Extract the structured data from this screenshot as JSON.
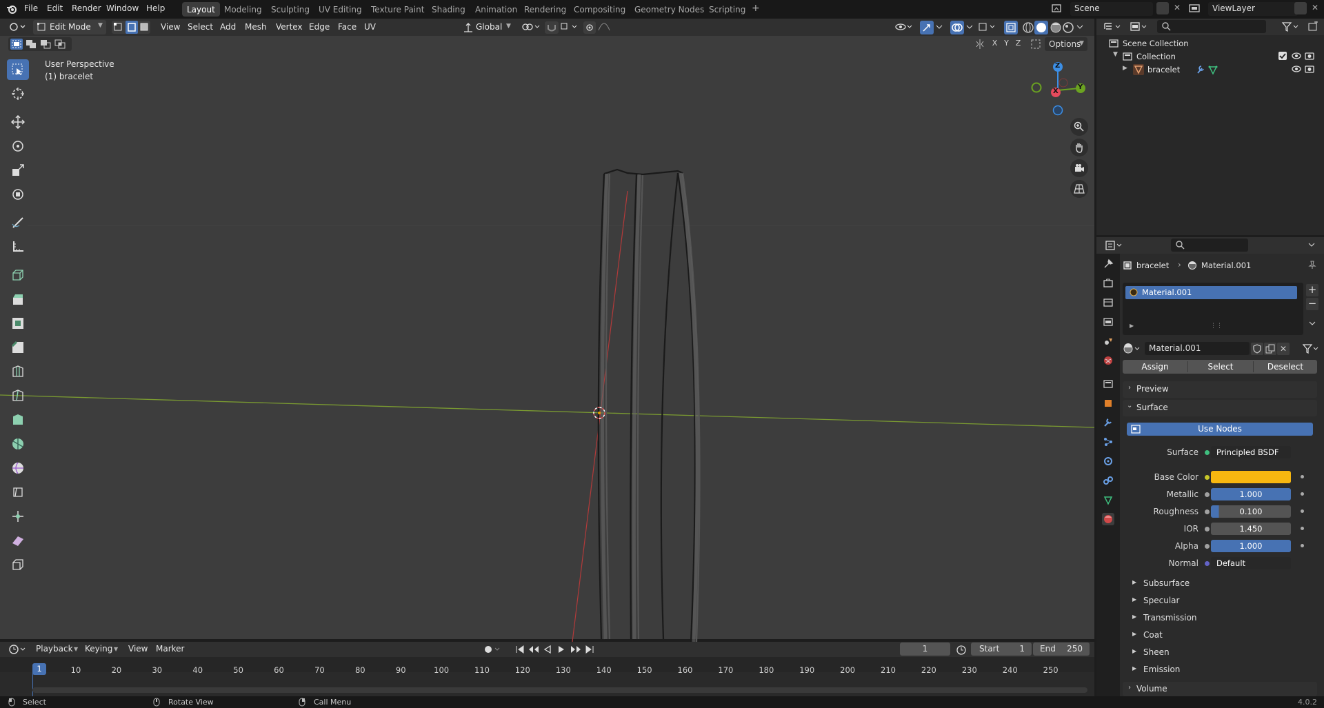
{
  "topbar": {
    "menus": [
      "File",
      "Edit",
      "Render",
      "Window",
      "Help"
    ],
    "workspaces": [
      "Layout",
      "Modeling",
      "Sculpting",
      "UV Editing",
      "Texture Paint",
      "Shading",
      "Animation",
      "Rendering",
      "Compositing",
      "Geometry Nodes",
      "Scripting"
    ],
    "active_workspace": "Layout",
    "scene": "Scene",
    "view_layer": "ViewLayer"
  },
  "viewport_header": {
    "mode": "Edit Mode",
    "menus": [
      "View",
      "Select",
      "Add",
      "Mesh",
      "Vertex",
      "Edge",
      "Face",
      "UV"
    ],
    "transform_orientation": "Global",
    "axes": [
      "X",
      "Y",
      "Z"
    ],
    "options": "Options"
  },
  "viewport": {
    "perspective": "User Perspective",
    "object": "(1) bracelet",
    "gizmo_axes": {
      "z": "Z",
      "x": "X",
      "y": "Y"
    }
  },
  "outliner": {
    "scene_collection": "Scene Collection",
    "collection": "Collection",
    "object": "bracelet"
  },
  "properties": {
    "breadcrumb_object": "bracelet",
    "breadcrumb_material": "Material.001",
    "slot": "Material.001",
    "material_name": "Material.001",
    "buttons": {
      "assign": "Assign",
      "select": "Select",
      "deselect": "Deselect"
    },
    "panels": {
      "preview": "Preview",
      "surface": "Surface",
      "volume": "Volume"
    },
    "use_nodes": "Use Nodes",
    "surface_label": "Surface",
    "surface_value": "Principled BSDF",
    "inputs": [
      {
        "label": "Base Color",
        "value": "",
        "color": "#f7b710"
      },
      {
        "label": "Metallic",
        "value": "1.000",
        "fill": 1.0
      },
      {
        "label": "Roughness",
        "value": "0.100",
        "fill": 0.1
      },
      {
        "label": "IOR",
        "value": "1.450",
        "fill": 0.0
      },
      {
        "label": "Alpha",
        "value": "1.000",
        "fill": 1.0
      },
      {
        "label": "Normal",
        "value": "Default"
      }
    ],
    "subpanels": [
      "Subsurface",
      "Specular",
      "Transmission",
      "Coat",
      "Sheen",
      "Emission"
    ]
  },
  "timeline": {
    "menus": [
      "Playback",
      "Keying",
      "View",
      "Marker"
    ],
    "current_frame": "1",
    "start_label": "Start",
    "start": "1",
    "end_label": "End",
    "end": "250",
    "ruler": [
      "1",
      "10",
      "20",
      "30",
      "40",
      "50",
      "60",
      "70",
      "80",
      "90",
      "100",
      "110",
      "120",
      "130",
      "140",
      "150",
      "160",
      "170",
      "180",
      "190",
      "200",
      "210",
      "220",
      "230",
      "240",
      "250"
    ]
  },
  "statusbar": {
    "select": "Select",
    "rotate": "Rotate View",
    "call_menu": "Call Menu",
    "version": "4.0.2"
  },
  "colors": {
    "accent": "#4772b3",
    "base_color": "#f7b710",
    "x_axis": "#e64a5c",
    "y_axis": "#6ba321",
    "z_axis": "#3c8fe6"
  }
}
